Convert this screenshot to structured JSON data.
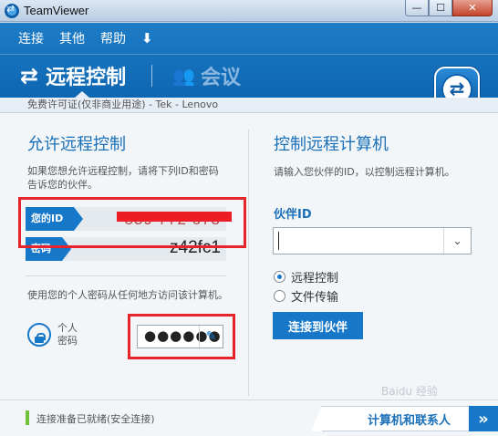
{
  "window": {
    "title": "TeamViewer",
    "min_glyph": "—",
    "max_glyph": "☐",
    "close_glyph": "✕"
  },
  "menu": {
    "connect": "连接",
    "other": "其他",
    "help": "帮助",
    "download_glyph": "⬇"
  },
  "tabs": {
    "remote_control": "远程控制",
    "meeting": "会议"
  },
  "license_text": "免费许可证(仅非商业用途) - Tek - Lenovo",
  "left_panel": {
    "heading": "允许远程控制",
    "description": "如果您想允许远程控制，请将下列ID和密码告诉您的伙伴。",
    "id_label": "您的ID",
    "id_value": "839 772 673",
    "password_label": "密码",
    "password_value": "z42fc1",
    "personal_description": "使用您的个人密码从任何地方访问该计算机。",
    "personal_password_label": "个人\n密码",
    "personal_password_masked": "●●●●●●"
  },
  "right_panel": {
    "heading": "控制远程计算机",
    "description": "请输入您伙伴的ID，以控制远程计算机。",
    "partner_id_label": "伙伴ID",
    "partner_id_value": "",
    "radio_remote": "远程控制",
    "radio_file": "文件传输",
    "connect_button": "连接到伙伴",
    "selected_mode": "远程控制"
  },
  "footer": {
    "status": "连接准备已就绪(安全连接)",
    "contacts_button": "计算机和联系人",
    "arrow_glyph": "»"
  },
  "colors": {
    "brand_blue": "#1778c9",
    "header_blue": "#0d66b1",
    "highlight_red": "#e8242a",
    "status_green": "#72c239"
  },
  "watermark": "Baidu 经验"
}
